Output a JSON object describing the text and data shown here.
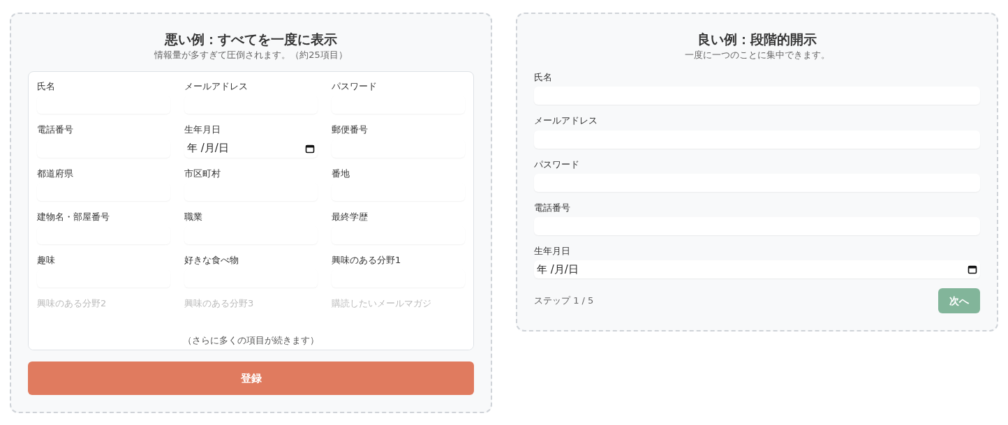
{
  "bad_example": {
    "title": "悪い例：すべてを一度に表示",
    "subtitle": "情報量が多すぎて圧倒されます。（約25項目）",
    "fields": [
      {
        "label": "氏名",
        "kind": "text",
        "faded": false
      },
      {
        "label": "メールアドレス",
        "kind": "text",
        "faded": false
      },
      {
        "label": "パスワード",
        "kind": "text",
        "faded": false
      },
      {
        "label": "電話番号",
        "kind": "text",
        "faded": false
      },
      {
        "label": "生年月日",
        "kind": "date",
        "placeholder": "年 /月/日",
        "faded": false
      },
      {
        "label": "郵便番号",
        "kind": "text",
        "faded": false
      },
      {
        "label": "都道府県",
        "kind": "text",
        "faded": false
      },
      {
        "label": "市区町村",
        "kind": "text",
        "faded": false
      },
      {
        "label": "番地",
        "kind": "text",
        "faded": false
      },
      {
        "label": "建物名・部屋番号",
        "kind": "text",
        "faded": false
      },
      {
        "label": "職業",
        "kind": "text",
        "faded": false
      },
      {
        "label": "最終学歴",
        "kind": "text",
        "faded": false
      },
      {
        "label": "趣味",
        "kind": "text",
        "faded": false
      },
      {
        "label": "好きな食べ物",
        "kind": "text",
        "faded": false
      },
      {
        "label": "興味のある分野1",
        "kind": "text",
        "faded": false
      },
      {
        "label": "興味のある分野2",
        "faded": true
      },
      {
        "label": "興味のある分野3",
        "faded": true
      },
      {
        "label": "購読したいメールマガジ",
        "faded": true
      }
    ],
    "more_note": "（さらに多くの項目が続きます）",
    "submit_button": "登録"
  },
  "good_example": {
    "title": "良い例：段階的開示",
    "subtitle": "一度に一つのことに集中できます。",
    "fields": [
      {
        "label": "氏名",
        "kind": "text"
      },
      {
        "label": "メールアドレス",
        "kind": "text"
      },
      {
        "label": "パスワード",
        "kind": "text"
      },
      {
        "label": "電話番号",
        "kind": "text"
      },
      {
        "label": "生年月日",
        "kind": "date",
        "placeholder": "年 /月/日"
      }
    ],
    "step": "ステップ 1 / 5",
    "next_button": "次へ"
  }
}
